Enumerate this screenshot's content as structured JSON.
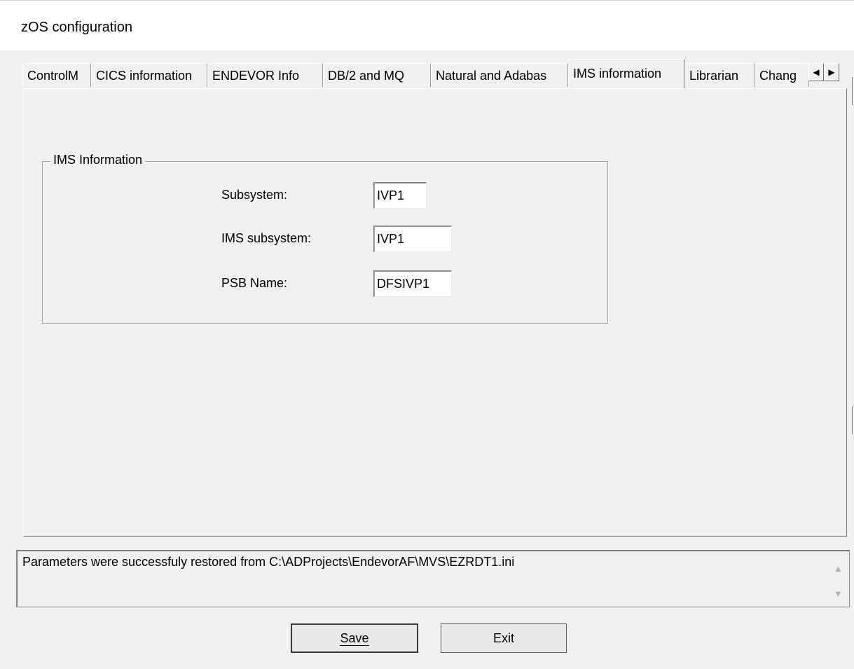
{
  "window": {
    "title": "zOS configuration"
  },
  "tabs": [
    {
      "label": "ControlM",
      "active": false
    },
    {
      "label": "CICS information",
      "active": false
    },
    {
      "label": "ENDEVOR Info",
      "active": false
    },
    {
      "label": "DB/2 and MQ",
      "active": false
    },
    {
      "label": "Natural and Adabas",
      "active": false
    },
    {
      "label": "IMS information",
      "active": true
    },
    {
      "label": "Librarian",
      "active": false
    },
    {
      "label": "Chang",
      "active": false
    }
  ],
  "tab_scroll": {
    "left_icon": "scroll-left-icon",
    "right_icon": "scroll-right-icon"
  },
  "group": {
    "legend": "IMS Information",
    "fields": [
      {
        "label": "Subsystem:",
        "value": "IVP1"
      },
      {
        "label": "IMS subsystem:",
        "value": "IVP1"
      },
      {
        "label": "PSB Name:",
        "value": "DFSIVP1"
      }
    ]
  },
  "status": {
    "message": "Parameters were successfuly restored from C:\\ADProjects\\EndevorAF\\MVS\\EZRDT1.ini"
  },
  "buttons": {
    "save": "Save",
    "exit": "Exit"
  }
}
